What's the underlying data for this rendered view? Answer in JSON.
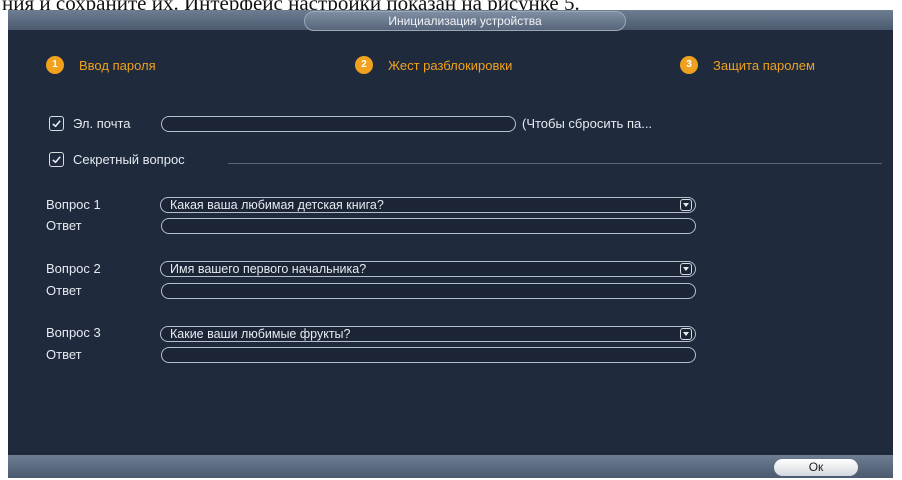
{
  "doc_text_above": "ния и сохраните их. Интерфейс настройки показан на рисунке 5.",
  "window": {
    "title": "Инициализация устройства"
  },
  "steps": [
    {
      "num": "1",
      "label": "Ввод пароля"
    },
    {
      "num": "2",
      "label": "Жест разблокировки"
    },
    {
      "num": "3",
      "label": "Защита паролем"
    }
  ],
  "email": {
    "checked": true,
    "label": "Эл. почта",
    "value": "",
    "hint": "(Чтобы сбросить па..."
  },
  "secret": {
    "checked": true,
    "label": "Секретный вопрос"
  },
  "questions": [
    {
      "label": "Вопрос 1",
      "selected": "Какая ваша любимая детская книга?",
      "answer_label": "Ответ",
      "answer": ""
    },
    {
      "label": "Вопрос 2",
      "selected": "Имя вашего первого начальника?",
      "answer_label": "Ответ",
      "answer": ""
    },
    {
      "label": "Вопрос 3",
      "selected": "Какие ваши любимые фрукты?",
      "answer_label": "Ответ",
      "answer": ""
    }
  ],
  "footer": {
    "ok_label": "Ок"
  },
  "colors": {
    "background": "#1f2a3d",
    "accent": "#f0a11e",
    "bar": "#5b6a7f"
  }
}
